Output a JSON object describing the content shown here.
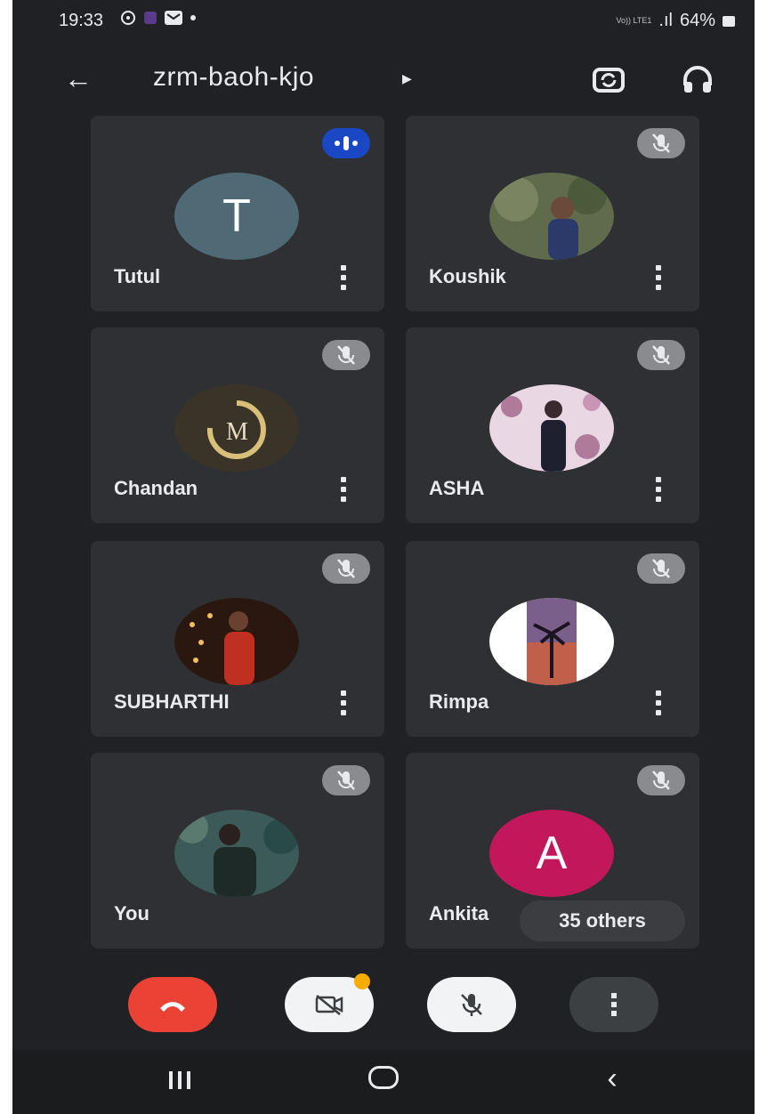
{
  "status_bar": {
    "time": "19:33",
    "network_label": "Vo)) LTE1",
    "signal_text": ".ıl",
    "battery": "64%"
  },
  "app_bar": {
    "meeting_code": "zrm-baoh-kjo",
    "back_icon": "arrow-left-icon",
    "switch_camera_icon": "switch-camera-icon",
    "audio_output_icon": "headphones-icon"
  },
  "participants": [
    {
      "name": "Tutul",
      "avatar_letter": "T",
      "avatar_color": "#4f6a74",
      "status": "speaking"
    },
    {
      "name": "Koushik",
      "avatar_color": "#5f6b4a",
      "status": "muted"
    },
    {
      "name": "Chandan",
      "avatar_color": "#3a3428",
      "status": "muted"
    },
    {
      "name": "ASHA",
      "avatar_color": "#b07a9a",
      "status": "muted"
    },
    {
      "name": "SUBHARTHI",
      "avatar_color": "#4a2418",
      "status": "muted"
    },
    {
      "name": "Rimpa",
      "avatar_color": "#7a5f6a",
      "status": "muted"
    },
    {
      "name": "You",
      "avatar_color": "#3b5a58",
      "status": "muted"
    },
    {
      "name": "Ankita",
      "avatar_letter": "A",
      "avatar_color": "#c2185b",
      "status": "muted"
    }
  ],
  "others_label": "35 others",
  "controls": {
    "end_call_icon": "phone-hangup-icon",
    "camera_icon": "camera-off-icon",
    "mic_icon": "mic-off-icon",
    "more_icon": "more-vert-icon"
  },
  "colors": {
    "background": "#202124",
    "tile": "#2f3033",
    "end_call": "#ea4335",
    "speaking": "#1a47c4"
  }
}
